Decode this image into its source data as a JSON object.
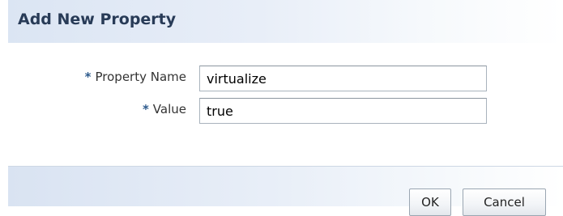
{
  "dialog": {
    "title": "Add New Property"
  },
  "form": {
    "required_marker": "*",
    "property_name": {
      "label": "Property Name",
      "value": "virtualize"
    },
    "value": {
      "label": "Value",
      "value": "true"
    }
  },
  "footer": {
    "ok_label": "OK",
    "cancel_label": "Cancel"
  },
  "colors": {
    "title_text": "#283b57",
    "required_marker": "#2d5a8c",
    "header_gradient_start": "#dbe5f3",
    "input_border": "#a9b3bd"
  }
}
